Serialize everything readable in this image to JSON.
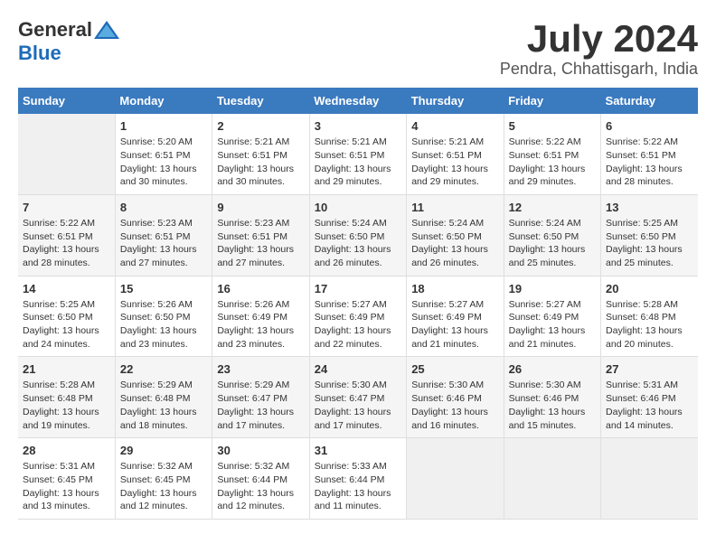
{
  "header": {
    "logo_general": "General",
    "logo_blue": "Blue",
    "month_year": "July 2024",
    "location": "Pendra, Chhattisgarh, India"
  },
  "calendar": {
    "days_of_week": [
      "Sunday",
      "Monday",
      "Tuesday",
      "Wednesday",
      "Thursday",
      "Friday",
      "Saturday"
    ],
    "weeks": [
      [
        {
          "day": "",
          "empty": true
        },
        {
          "day": "1",
          "sunrise": "5:20 AM",
          "sunset": "6:51 PM",
          "daylight": "13 hours and 30 minutes."
        },
        {
          "day": "2",
          "sunrise": "5:21 AM",
          "sunset": "6:51 PM",
          "daylight": "13 hours and 30 minutes."
        },
        {
          "day": "3",
          "sunrise": "5:21 AM",
          "sunset": "6:51 PM",
          "daylight": "13 hours and 29 minutes."
        },
        {
          "day": "4",
          "sunrise": "5:21 AM",
          "sunset": "6:51 PM",
          "daylight": "13 hours and 29 minutes."
        },
        {
          "day": "5",
          "sunrise": "5:22 AM",
          "sunset": "6:51 PM",
          "daylight": "13 hours and 29 minutes."
        },
        {
          "day": "6",
          "sunrise": "5:22 AM",
          "sunset": "6:51 PM",
          "daylight": "13 hours and 28 minutes."
        }
      ],
      [
        {
          "day": "7",
          "sunrise": "5:22 AM",
          "sunset": "6:51 PM",
          "daylight": "13 hours and 28 minutes."
        },
        {
          "day": "8",
          "sunrise": "5:23 AM",
          "sunset": "6:51 PM",
          "daylight": "13 hours and 27 minutes."
        },
        {
          "day": "9",
          "sunrise": "5:23 AM",
          "sunset": "6:51 PM",
          "daylight": "13 hours and 27 minutes."
        },
        {
          "day": "10",
          "sunrise": "5:24 AM",
          "sunset": "6:50 PM",
          "daylight": "13 hours and 26 minutes."
        },
        {
          "day": "11",
          "sunrise": "5:24 AM",
          "sunset": "6:50 PM",
          "daylight": "13 hours and 26 minutes."
        },
        {
          "day": "12",
          "sunrise": "5:24 AM",
          "sunset": "6:50 PM",
          "daylight": "13 hours and 25 minutes."
        },
        {
          "day": "13",
          "sunrise": "5:25 AM",
          "sunset": "6:50 PM",
          "daylight": "13 hours and 25 minutes."
        }
      ],
      [
        {
          "day": "14",
          "sunrise": "5:25 AM",
          "sunset": "6:50 PM",
          "daylight": "13 hours and 24 minutes."
        },
        {
          "day": "15",
          "sunrise": "5:26 AM",
          "sunset": "6:50 PM",
          "daylight": "13 hours and 23 minutes."
        },
        {
          "day": "16",
          "sunrise": "5:26 AM",
          "sunset": "6:49 PM",
          "daylight": "13 hours and 23 minutes."
        },
        {
          "day": "17",
          "sunrise": "5:27 AM",
          "sunset": "6:49 PM",
          "daylight": "13 hours and 22 minutes."
        },
        {
          "day": "18",
          "sunrise": "5:27 AM",
          "sunset": "6:49 PM",
          "daylight": "13 hours and 21 minutes."
        },
        {
          "day": "19",
          "sunrise": "5:27 AM",
          "sunset": "6:49 PM",
          "daylight": "13 hours and 21 minutes."
        },
        {
          "day": "20",
          "sunrise": "5:28 AM",
          "sunset": "6:48 PM",
          "daylight": "13 hours and 20 minutes."
        }
      ],
      [
        {
          "day": "21",
          "sunrise": "5:28 AM",
          "sunset": "6:48 PM",
          "daylight": "13 hours and 19 minutes."
        },
        {
          "day": "22",
          "sunrise": "5:29 AM",
          "sunset": "6:48 PM",
          "daylight": "13 hours and 18 minutes."
        },
        {
          "day": "23",
          "sunrise": "5:29 AM",
          "sunset": "6:47 PM",
          "daylight": "13 hours and 17 minutes."
        },
        {
          "day": "24",
          "sunrise": "5:30 AM",
          "sunset": "6:47 PM",
          "daylight": "13 hours and 17 minutes."
        },
        {
          "day": "25",
          "sunrise": "5:30 AM",
          "sunset": "6:46 PM",
          "daylight": "13 hours and 16 minutes."
        },
        {
          "day": "26",
          "sunrise": "5:30 AM",
          "sunset": "6:46 PM",
          "daylight": "13 hours and 15 minutes."
        },
        {
          "day": "27",
          "sunrise": "5:31 AM",
          "sunset": "6:46 PM",
          "daylight": "13 hours and 14 minutes."
        }
      ],
      [
        {
          "day": "28",
          "sunrise": "5:31 AM",
          "sunset": "6:45 PM",
          "daylight": "13 hours and 13 minutes."
        },
        {
          "day": "29",
          "sunrise": "5:32 AM",
          "sunset": "6:45 PM",
          "daylight": "13 hours and 12 minutes."
        },
        {
          "day": "30",
          "sunrise": "5:32 AM",
          "sunset": "6:44 PM",
          "daylight": "13 hours and 12 minutes."
        },
        {
          "day": "31",
          "sunrise": "5:33 AM",
          "sunset": "6:44 PM",
          "daylight": "13 hours and 11 minutes."
        },
        {
          "day": "",
          "empty": true
        },
        {
          "day": "",
          "empty": true
        },
        {
          "day": "",
          "empty": true
        }
      ]
    ],
    "sunrise_label": "Sunrise:",
    "sunset_label": "Sunset:",
    "daylight_label": "Daylight:"
  }
}
